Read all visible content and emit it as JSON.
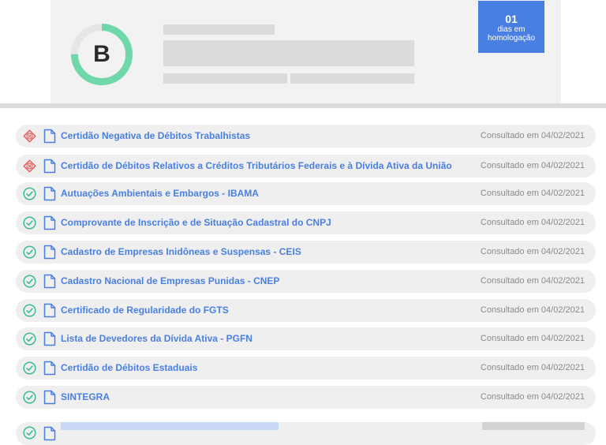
{
  "company": {
    "grade": "B",
    "grade_fraction": 0.75,
    "days_count": "01",
    "days_label_line1": "dias em",
    "days_label_line2": "homologação"
  },
  "colors": {
    "accent": "#4a7fe2",
    "ok": "#3dbb8a",
    "error": "#e05a5a",
    "ring": "#6fd8ab"
  },
  "documents": [
    {
      "title": "Certidão Negativa de Débitos Trabalhistas",
      "status": "error",
      "status_icon": "error-x-icon",
      "consulted": "Consultado em 04/02/2021"
    },
    {
      "title": "Certidão de Débitos Relativos a Créditos Tributários Federais e à Dívida Ativa da União",
      "status": "error",
      "status_icon": "error-x-icon",
      "consulted": "Consultado em 04/02/2021"
    },
    {
      "title": "Autuações Ambientais e Embargos - IBAMA",
      "status": "ok",
      "status_icon": "check-circle-icon",
      "consulted": "Consultado em 04/02/2021"
    },
    {
      "title": "Comprovante de Inscrição e de Situação Cadastral do CNPJ",
      "status": "ok",
      "status_icon": "check-circle-icon",
      "consulted": "Consultado em 04/02/2021"
    },
    {
      "title": "Cadastro de Empresas Inidôneas e Suspensas - CEIS",
      "status": "ok",
      "status_icon": "check-circle-icon",
      "consulted": "Consultado em 04/02/2021"
    },
    {
      "title": "Cadastro Nacional de Empresas Punidas - CNEP",
      "status": "ok",
      "status_icon": "check-circle-icon",
      "consulted": "Consultado em 04/02/2021"
    },
    {
      "title": "Certificado de Regularidade do FGTS",
      "status": "ok",
      "status_icon": "check-circle-icon",
      "consulted": "Consultado em 04/02/2021"
    },
    {
      "title": "Lista de Devedores da Dívida Ativa - PGFN",
      "status": "ok",
      "status_icon": "check-circle-icon",
      "consulted": "Consultado em 04/02/2021"
    },
    {
      "title": "Certidão de Débitos Estaduais",
      "status": "ok",
      "status_icon": "check-circle-icon",
      "consulted": "Consultado em 04/02/2021"
    },
    {
      "title": "SINTEGRA",
      "status": "ok",
      "status_icon": "check-circle-icon",
      "consulted": "Consultado em 04/02/2021"
    }
  ]
}
